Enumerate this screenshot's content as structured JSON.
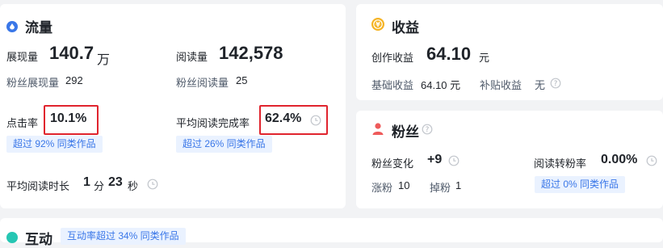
{
  "traffic": {
    "title": "流量",
    "impressions_label": "展现量",
    "impressions_value": "140.7",
    "impressions_unit": "万",
    "fan_impressions_label": "粉丝展现量",
    "fan_impressions_value": "292",
    "reads_label": "阅读量",
    "reads_value": "142,578",
    "fan_reads_label": "粉丝阅读量",
    "fan_reads_value": "25",
    "ctr_label": "点击率",
    "ctr_value": "10.1%",
    "ctr_badge": "超过 92% 同类作品",
    "completion_label": "平均阅读完成率",
    "completion_value": "62.4%",
    "completion_badge": "超过 26% 同类作品",
    "avg_time_label": "平均阅读时长",
    "avg_time_min": "1",
    "avg_time_min_unit": "分",
    "avg_time_sec": "23",
    "avg_time_sec_unit": "秒"
  },
  "earnings": {
    "title": "收益",
    "creation_label": "创作收益",
    "creation_value": "64.10",
    "creation_unit": "元",
    "base_label": "基础收益",
    "base_value": "64.10 元",
    "subsidy_label": "补贴收益",
    "subsidy_value": "无"
  },
  "fans": {
    "title": "粉丝",
    "change_label": "粉丝变化",
    "change_value": "+9",
    "conversion_label": "阅读转粉率",
    "conversion_value": "0.00%",
    "gained_label": "涨粉",
    "gained_value": "10",
    "lost_label": "掉粉",
    "lost_value": "1",
    "conversion_badge": "超过 0% 同类作品"
  },
  "interaction": {
    "title": "互动",
    "badge": "互动率超过 34% 同类作品"
  },
  "colors": {
    "traffic_icon": "#3a77e8",
    "earnings_icon": "#f5b323",
    "fans_icon": "#ee5a5a",
    "interaction_icon": "#26c6b3",
    "highlight": "#e0242e",
    "badge_text": "#3a77e8",
    "badge_bg": "#eaf2ff"
  },
  "icons": [
    "traffic-drop-icon",
    "coin-icon",
    "person-icon",
    "help-icon",
    "clock-icon",
    "interaction-dot-icon"
  ]
}
